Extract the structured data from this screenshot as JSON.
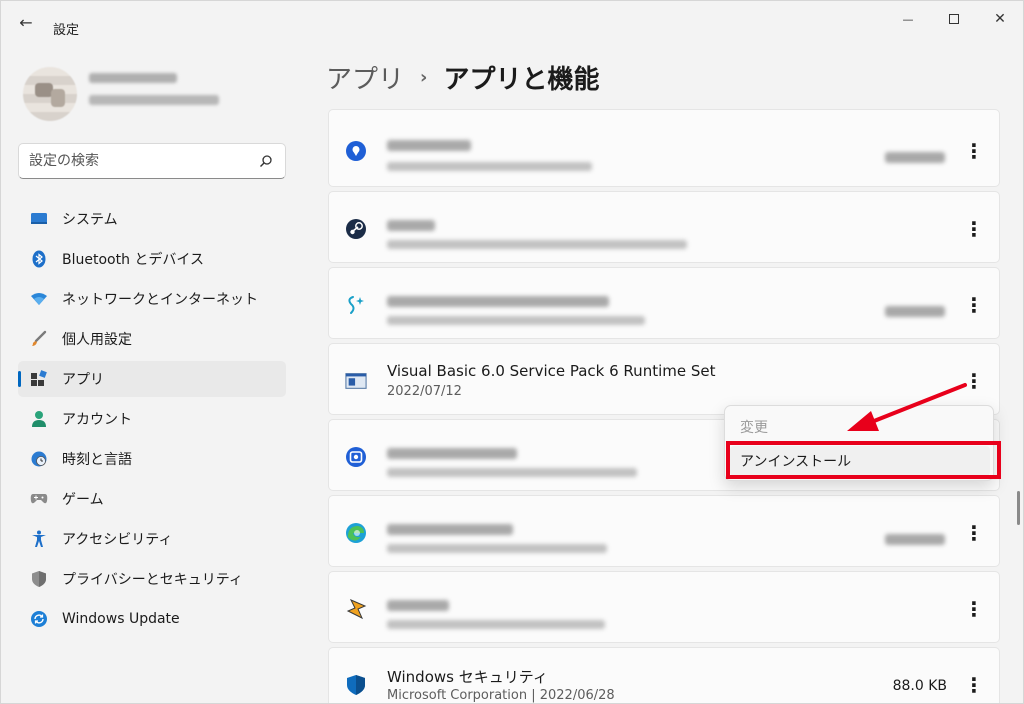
{
  "window": {
    "title": "設定",
    "back_glyph": "←",
    "minimize_glyph": "—",
    "close_glyph": "✕"
  },
  "search": {
    "placeholder": "設定の検索"
  },
  "nav": {
    "items": [
      {
        "label": "システム",
        "icon": "monitor-icon"
      },
      {
        "label": "Bluetooth とデバイス",
        "icon": "bluetooth-icon"
      },
      {
        "label": "ネットワークとインターネット",
        "icon": "wifi-icon"
      },
      {
        "label": "個人用設定",
        "icon": "brush-icon"
      },
      {
        "label": "アプリ",
        "icon": "apps-icon",
        "active": true
      },
      {
        "label": "アカウント",
        "icon": "person-icon"
      },
      {
        "label": "時刻と言語",
        "icon": "clock-globe-icon"
      },
      {
        "label": "ゲーム",
        "icon": "gamepad-icon"
      },
      {
        "label": "アクセシビリティ",
        "icon": "accessibility-icon"
      },
      {
        "label": "プライバシーとセキュリティ",
        "icon": "shield-icon"
      },
      {
        "label": "Windows Update",
        "icon": "update-icon"
      }
    ]
  },
  "breadcrumb": {
    "parent": "アプリ",
    "separator": "›",
    "current": "アプリと機能"
  },
  "apps": {
    "visual_basic": {
      "name": "Visual Basic 6.0 Service Pack 6 Runtime Set",
      "meta": "2022/07/12"
    },
    "windows_security": {
      "name": "Windows セキュリティ",
      "meta": "Microsoft Corporation  |  2022/06/28",
      "size": "88.0 KB"
    },
    "more_glyph": "⋮"
  },
  "context_menu": {
    "modify": "変更",
    "uninstall": "アンインストール"
  },
  "colors": {
    "accent": "#0067c0",
    "highlight": "#e8001b"
  }
}
